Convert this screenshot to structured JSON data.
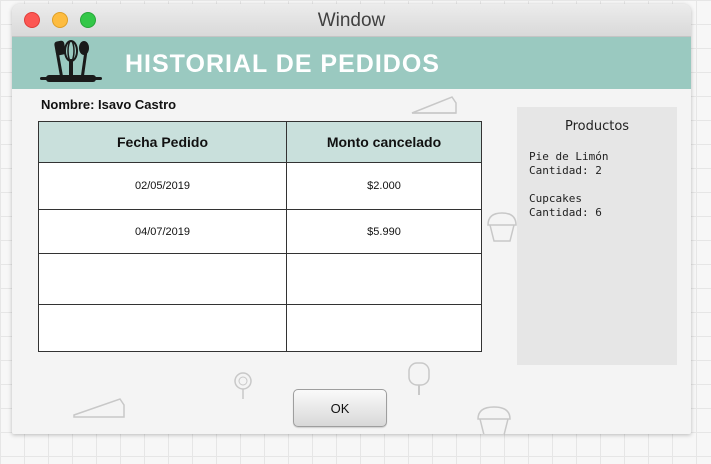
{
  "window": {
    "title": "Window",
    "controls": [
      "close",
      "minimize",
      "maximize"
    ]
  },
  "banner": {
    "title": "HISTORIAL DE PEDIDOS",
    "logo_icon": "kitchen-utensils-icon",
    "color": "#9ac9c0"
  },
  "customer": {
    "name_line": "Nombre: Isavo Castro"
  },
  "orders_table": {
    "columns": [
      "Fecha Pedido",
      "Monto cancelado"
    ],
    "rows": [
      [
        "02/05/2019",
        "$2.000"
      ],
      [
        "04/07/2019",
        "$5.990"
      ],
      [
        "",
        ""
      ],
      [
        "",
        ""
      ]
    ]
  },
  "products_panel": {
    "title": "Productos",
    "items": [
      {
        "name": "Pie de Limón",
        "quantity": "Cantidad: 2"
      },
      {
        "name": "Cupcakes",
        "quantity": "Cantidad: 6"
      }
    ]
  },
  "ok_button": {
    "label": "OK"
  }
}
